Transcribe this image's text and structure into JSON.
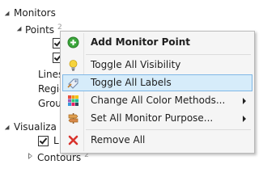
{
  "tree": {
    "monitors_label": "Monitors",
    "points_label": "Points",
    "points_count": "2",
    "lines_label": "Lines",
    "regions_label": "Regio",
    "groups_label": "Grou",
    "visualization_label": "Visualiza",
    "visualization_child_label": "L",
    "contours_label": "Contours",
    "contours_count": "2"
  },
  "context_menu": {
    "items": [
      {
        "label": "Add Monitor Point",
        "icon": "add-green-circle-icon",
        "bold": true
      },
      {
        "label": "Toggle All Visibility",
        "icon": "lightbulb-icon"
      },
      {
        "label": "Toggle All Labels",
        "icon": "label-tag-icon",
        "highlighted": true
      },
      {
        "label": "Change All Color Methods...",
        "icon": "color-grid-icon",
        "submenu": true
      },
      {
        "label": "Set All Monitor Purpose...",
        "icon": "purpose-signpost-icon",
        "submenu": true
      },
      {
        "label": "Remove All",
        "icon": "red-x-icon"
      }
    ]
  },
  "colors": {
    "highlight_bg": "#d6ecfa",
    "highlight_border": "#7fb7e6",
    "menu_bg": "#f5f5f5",
    "add_green": "#3aa63a",
    "remove_red": "#d8322c"
  }
}
